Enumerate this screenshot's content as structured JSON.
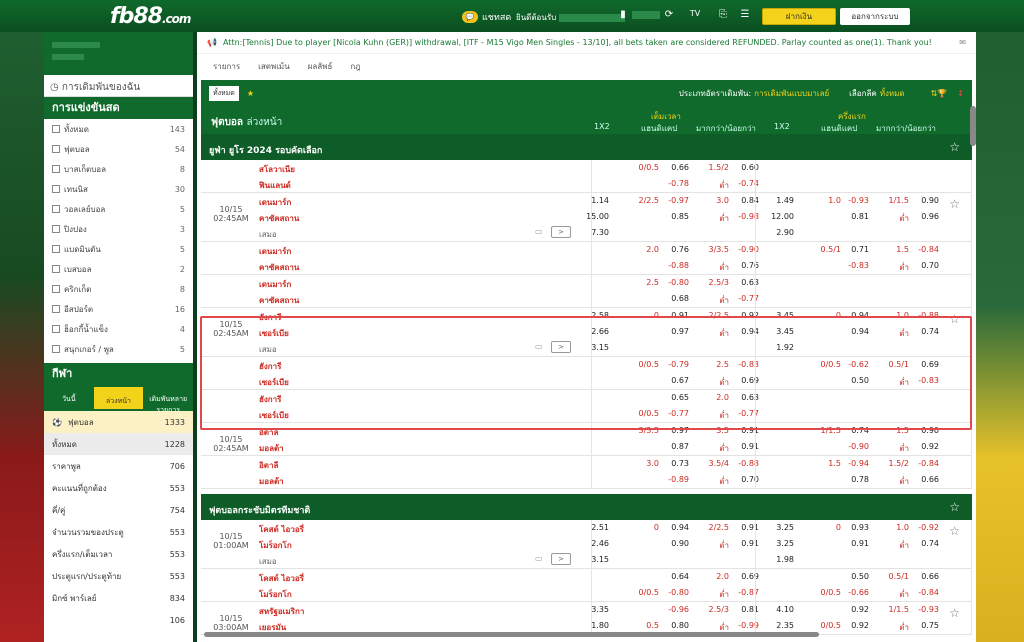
{
  "header": {
    "logo": "fb88",
    "logo_suffix": ".com",
    "chat_label": "แชทสด",
    "welcome": "ยินดีต้อนรับ",
    "deposit": "ฝากเงิน",
    "logout": "ออกจากระบบ"
  },
  "sidebar": {
    "my_bets": "การเดิมพันของฉัน",
    "live_title": "การแข่งขันสด",
    "live_items": [
      {
        "label": "ทั้งหมด",
        "count": "143"
      },
      {
        "label": "ฟุตบอล",
        "count": "54"
      },
      {
        "label": "บาสเก็ตบอล",
        "count": "8"
      },
      {
        "label": "เทนนิส",
        "count": "30"
      },
      {
        "label": "วอลเลย์บอล",
        "count": "5"
      },
      {
        "label": "ปิงปอง",
        "count": "3"
      },
      {
        "label": "แบดมินตัน",
        "count": "5"
      },
      {
        "label": "เบสบอล",
        "count": "2"
      },
      {
        "label": "คริกเก็ต",
        "count": "8"
      },
      {
        "label": "อีสปอร์ต",
        "count": "16"
      },
      {
        "label": "ฮ็อกกี้น้ำแข็ง",
        "count": "4"
      },
      {
        "label": "สนุกเกอร์ / พูล",
        "count": "5"
      }
    ],
    "sports_title": "กีฬา",
    "tabs": [
      "วันนี้",
      "ล่วงหน้า",
      "เดิมพันหลายรายการ"
    ],
    "sports": [
      {
        "label": "ฟุตบอล",
        "count": "1333"
      },
      {
        "label": "ทั้งหมด",
        "count": "1228"
      },
      {
        "label": "ราคาพูล",
        "count": "706"
      },
      {
        "label": "คะแนนที่ถูกต้อง",
        "count": "553"
      },
      {
        "label": "คี่/คู่",
        "count": "754"
      },
      {
        "label": "จำนวนรวมของประตู",
        "count": "553"
      },
      {
        "label": "ครึ่งแรก/เต็มเวลา",
        "count": "553"
      },
      {
        "label": "ประตูแรก/ประตูท้าย",
        "count": "553"
      },
      {
        "label": "มิกซ์ พาร์เลย์",
        "count": "834"
      },
      {
        "label": "",
        "count": "106"
      }
    ]
  },
  "main": {
    "announcement": "Attn:[Tennis] Due to player [Nicola Kuhn (GER)] withdrawal, [ITF - M15 Vigo Men Singles - 13/10], all bets taken are considered REFUNDED. Parlay counted as one(1). Thank you!",
    "tabs": [
      "รายการ",
      "เสตพเม้น",
      "ผลลัพธ์",
      "กฎ"
    ],
    "all": "ทั้งหมด",
    "bet_type_label": "ประเภทอัตราเดิมพัน:",
    "bet_type_value": "การเดิมพันแบบมาเลย์",
    "odds_label": "เลือกลีค",
    "odds_value": "ทั้งหมด",
    "title": "ฟุตบอล",
    "title_sub": "ล่วงหน้า",
    "col_full": "เต็มเวลา",
    "col_half": "ครึ่งแรก",
    "c_1x2": "1X2",
    "c_hdp": "แฮนดิแคป",
    "c_ou": "มากกว่า/น้อยกว่า",
    "c_1x2b": "1X2",
    "c_hdpb": "แฮนดิแคป",
    "c_oub": "มากกว่า/น้อยกว่า",
    "league1": "ยูฟ่า ยูโร 2024 รอบคัดเลือก",
    "league2": "ฟุตบอลกระชับมิตรทีมชาติ"
  },
  "rows": [
    {
      "date": "",
      "teams": [
        "สโลวาเนีย",
        "ฟินแลนด์"
      ],
      "odds": [
        [
          "",
          "0/0.5",
          "0.66",
          "1.5/2",
          "0.60",
          "",
          "",
          "",
          "",
          ""
        ],
        [
          "",
          "",
          "-0.78",
          "ต่ำ",
          "-0.74",
          "",
          "",
          "",
          "",
          ""
        ]
      ]
    }
  ]
}
